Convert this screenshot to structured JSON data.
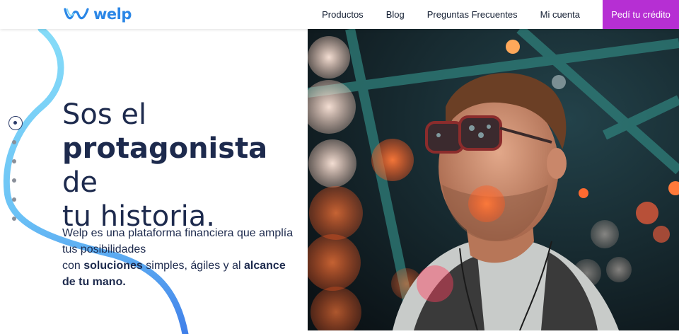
{
  "brand": {
    "name": "welp",
    "logo_icon": "welp-wave-logo",
    "color": "#2a86e6"
  },
  "nav": {
    "items": [
      "Productos",
      "Blog",
      "Preguntas Frecuentes",
      "Mi cuenta"
    ],
    "cta": "Pedí tu crédito",
    "cta_color": "#b62fd3"
  },
  "hero": {
    "title_1": "Sos el",
    "title_2_bold": "protagonista",
    "title_2_rest": " de",
    "title_3": "tu historia.",
    "desc_1": "Welp es una plataforma financiera que amplía tus posibilidades",
    "desc_2_prefix": "con ",
    "desc_2_bold": "soluciones",
    "desc_2_mid": " simples, ágiles y al ",
    "desc_2_bold2": "alcance de tu mano."
  },
  "slider": {
    "total": 6,
    "active": 1
  },
  "colors": {
    "text_dark": "#1d2a4d",
    "ribbon_light": "#7fd6f7",
    "ribbon_dark": "#3a7de8"
  }
}
